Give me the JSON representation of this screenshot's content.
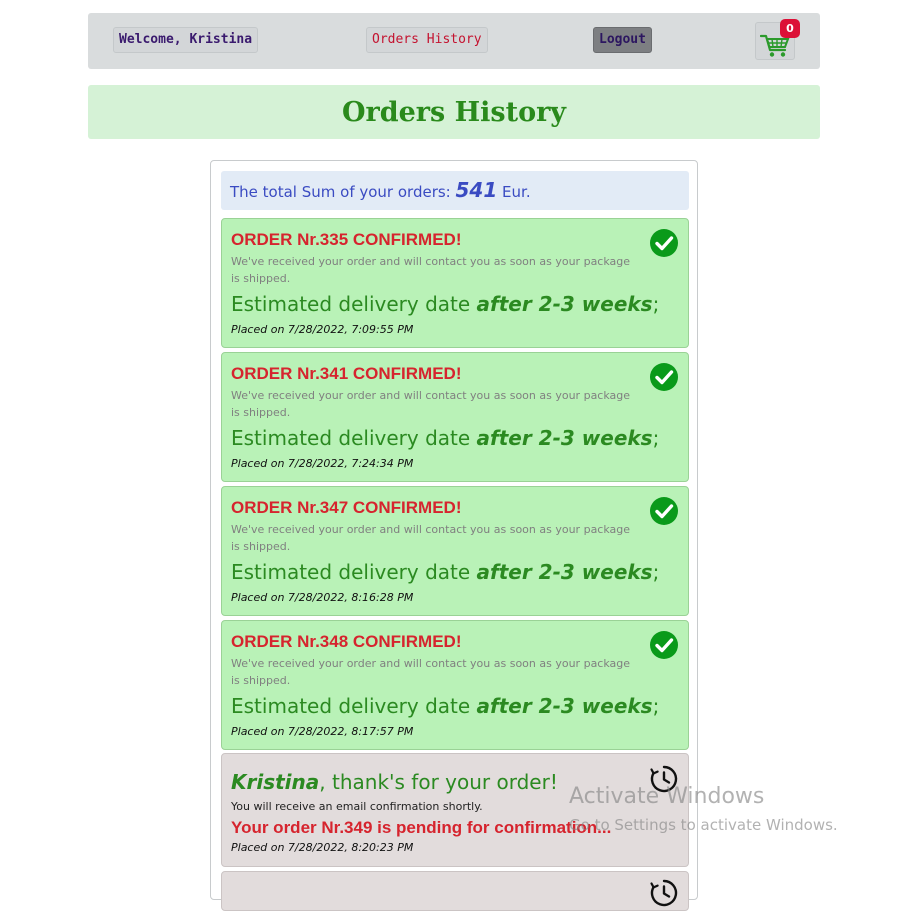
{
  "nav": {
    "welcome": "Welcome, Kristina",
    "orders_history": "Orders History",
    "logout": "Logout",
    "cart_count": "0"
  },
  "page_title": "Orders History",
  "summary": {
    "prefix": "The total Sum of your orders:",
    "total": "541",
    "currency": "Eur."
  },
  "orders": [
    {
      "title": "ORDER Nr.335 CONFIRMED!",
      "message": "We've received your order and will contact you as soon as your package is shipped.",
      "estimate_prefix": "Estimated delivery date",
      "estimate_value": "after 2-3 weeks",
      "estimate_suffix": ";",
      "placed": "Placed on 7/28/2022, 7:09:55 PM"
    },
    {
      "title": "ORDER Nr.341 CONFIRMED!",
      "message": "We've received your order and will contact you as soon as your package is shipped.",
      "estimate_prefix": "Estimated delivery date",
      "estimate_value": "after 2-3 weeks",
      "estimate_suffix": ";",
      "placed": "Placed on 7/28/2022, 7:24:34 PM"
    },
    {
      "title": "ORDER Nr.347 CONFIRMED!",
      "message": "We've received your order and will contact you as soon as your package is shipped.",
      "estimate_prefix": "Estimated delivery date",
      "estimate_value": "after 2-3 weeks",
      "estimate_suffix": ";",
      "placed": "Placed on 7/28/2022, 8:16:28 PM"
    },
    {
      "title": "ORDER Nr.348 CONFIRMED!",
      "message": "We've received your order and will contact you as soon as your package is shipped.",
      "estimate_prefix": "Estimated delivery date",
      "estimate_value": "after 2-3 weeks",
      "estimate_suffix": ";",
      "placed": "Placed on 7/28/2022, 8:17:57 PM"
    }
  ],
  "pending": {
    "name": "Kristina",
    "thanks": ", thank's for your order!",
    "email_note": "You will receive an email confirmation shortly.",
    "status": "Your order Nr.349 is pending for confirmation...",
    "placed": "Placed on 7/28/2022, 8:20:23 PM"
  },
  "watermark": {
    "title": "Activate Windows",
    "subtitle": "Go to Settings to activate Windows."
  },
  "icons": {
    "cart": "shopping-cart-icon",
    "confirmed": "check-circle-icon",
    "pending": "clock-history-icon"
  },
  "colors": {
    "confirmed_bg": "#b9f2b7",
    "pending_bg": "#e2dcdc",
    "accent_red": "#d6242e",
    "accent_green": "#2b8a21",
    "total_blue": "#3a4bc2"
  }
}
